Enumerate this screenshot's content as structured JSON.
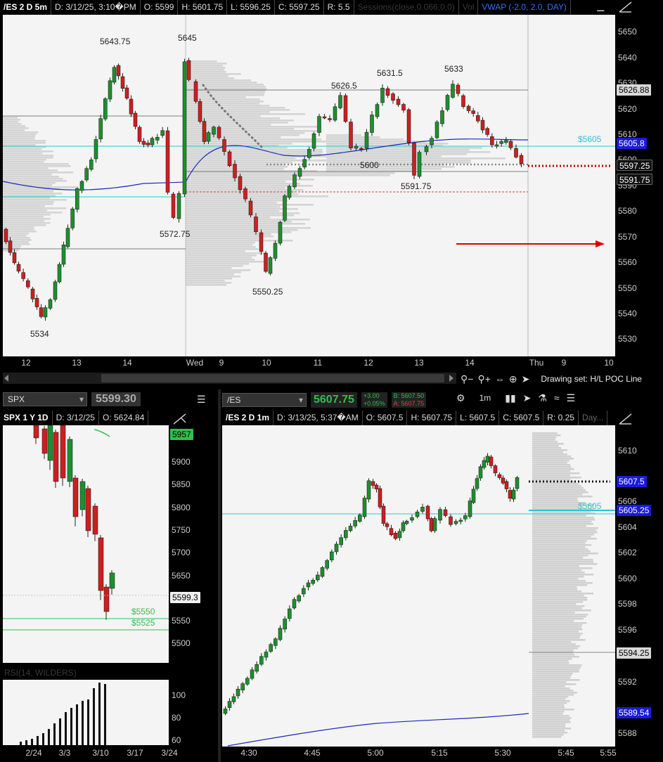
{
  "top_chart": {
    "header": {
      "symbol": "/ES 2 D 5m",
      "date": "D: 3/12/25, 3:10�PM",
      "open": "O: 5599",
      "high": "H: 5601.75",
      "low": "L: 5596.25",
      "close": "C: 5597.25",
      "range": "R: 5.5",
      "study1": "Sessions(close,0.066,0,0)",
      "study2": "Vol",
      "vwap": "VWAP (-2.0, 2.0, DAY)"
    },
    "price_labels": [
      "5650",
      "5640",
      "5630",
      "5620",
      "5610",
      "5600",
      "5590",
      "5580",
      "5570",
      "5560",
      "5550",
      "5540",
      "5530"
    ],
    "price_tags": [
      {
        "text": "5626.88",
        "bg": "#d8d8d8",
        "fg": "#000"
      },
      {
        "text": "5605.8",
        "bg": "#1b1bd8",
        "fg": "#fff"
      },
      {
        "text": "5597.25",
        "bg": "#111",
        "fg": "#fff"
      },
      {
        "text": "5591.75",
        "bg": "#111",
        "fg": "#fff"
      }
    ],
    "time_labels": [
      "12",
      "13",
      "14",
      "Wed",
      "9",
      "10",
      "11",
      "12",
      "13",
      "14",
      "Thu",
      "9",
      "10"
    ],
    "annotations": {
      "a1": "5643.75",
      "a2": "5645",
      "a3": "5626.5",
      "a4": "5631.5",
      "a5": "5633",
      "a6": "5534",
      "a7": "5572.75",
      "a8": "5550.25",
      "a9": "5600",
      "a10": "5591.75",
      "level_5605": "$5605"
    },
    "drawing_set": "Drawing set: H/L POC Line"
  },
  "spx_panel": {
    "symbol_select": "SPX",
    "last": "5599.30",
    "header": {
      "symbol": "SPX 1 Y 1D",
      "date": "D: 3/12/25",
      "open": "O: 5624.84"
    },
    "price_labels": [
      "5957",
      "5900",
      "5850",
      "5800",
      "5750",
      "5700",
      "5650",
      "5600",
      "5550",
      "5500"
    ],
    "last_tag": "5599.3",
    "alerts": [
      "$5550",
      "$5525"
    ],
    "study_label": "RSI(14, WILDERS)",
    "volume_labels": [
      "100",
      "80",
      "60"
    ],
    "time_labels": [
      "2/24",
      "3/3",
      "3/10",
      "3/17",
      "3/24"
    ]
  },
  "es_panel": {
    "symbol_select": "/ES",
    "last": "5607.75",
    "net_change": "+3.00",
    "pct_change": "+0.05%",
    "bid": "B: 5607.50",
    "ask": "A: 5607.75",
    "timeframe": "1m",
    "header": {
      "symbol": "/ES 2 D 1m",
      "date": "D: 3/13/25, 5:37�AM",
      "open": "O: 5607.5",
      "high": "H: 5607.75",
      "low": "L: 5607.5",
      "close": "C: 5607.5",
      "range": "R: 0.25",
      "study": "Day..."
    },
    "price_labels": [
      "5610",
      "5608",
      "5606",
      "5604",
      "5602",
      "5600",
      "5598",
      "5596",
      "5594",
      "5592",
      "5590",
      "5588"
    ],
    "price_tags": [
      {
        "text": "5607.5",
        "bg": "#1b1bd8",
        "fg": "#fff"
      },
      {
        "text": "5605.25",
        "bg": "#1b1bd8",
        "fg": "#fff"
      },
      {
        "text": "5594.25",
        "bg": "#d8d8d8",
        "fg": "#000"
      },
      {
        "text": "5589.54",
        "bg": "#1b1bd8",
        "fg": "#fff"
      }
    ],
    "level_5605": "$5605",
    "time_labels": [
      "4:30",
      "4:45",
      "5:00",
      "5:15",
      "5:30",
      "5:45",
      "5:55"
    ]
  },
  "colors": {
    "up": "#1e8f2e",
    "down": "#cc1f1f",
    "vwap": "#1a2bb8",
    "cyan": "#31c3d4",
    "accent_green": "#2fbf4f"
  }
}
